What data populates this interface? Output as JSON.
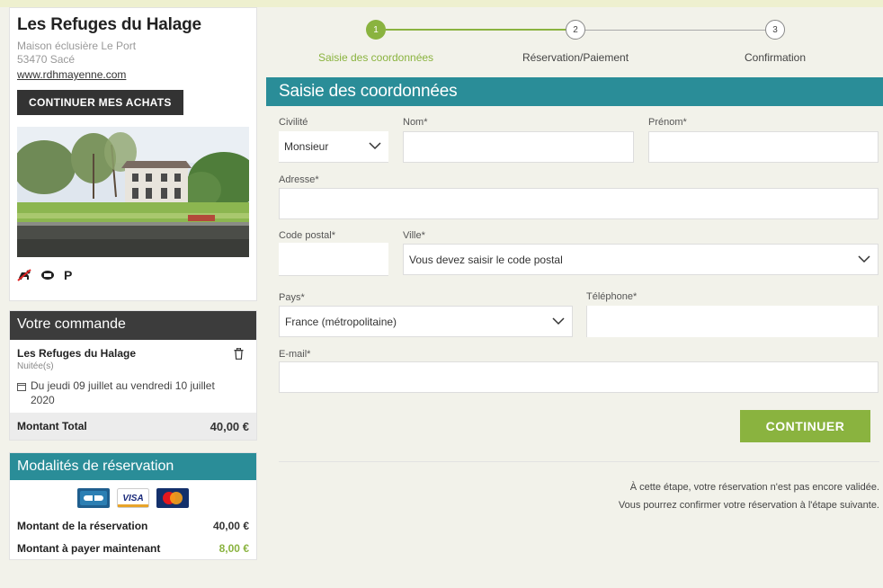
{
  "shop": {
    "name": "Les Refuges du Halage",
    "address_line1": "Maison éclusière Le Port",
    "address_line2": "53470 Sacé",
    "website": "www.rdhmayenne.com",
    "continue_shopping_label": "CONTINUER MES ACHATS",
    "amenity_icons": [
      "no-pets-icon",
      "tv-icon",
      "parking-icon"
    ],
    "parking_glyph": "P"
  },
  "order": {
    "title": "Votre commande",
    "item_name": "Les Refuges du Halage",
    "item_type": "Nuitée(s)",
    "date_line1": "Du jeudi 09 juillet au vendredi 10 juillet",
    "date_line2": "2020",
    "total_label": "Montant Total",
    "total_value": "40,00 €"
  },
  "booking_terms": {
    "title": "Modalités de réservation",
    "cards": [
      "CB",
      "VISA",
      "MasterCard"
    ],
    "amount_label": "Montant de la réservation",
    "amount_value": "40,00 €",
    "pay_now_label": "Montant à payer maintenant",
    "pay_now_value": "8,00 €"
  },
  "stepper": {
    "steps": [
      {
        "number": "1",
        "label": "Saisie des coordonnées",
        "active": true
      },
      {
        "number": "2",
        "label": "Réservation/Paiement",
        "active": false
      },
      {
        "number": "3",
        "label": "Confirmation",
        "active": false
      }
    ]
  },
  "form": {
    "section_title": "Saisie des coordonnées",
    "civilite_label": "Civilité",
    "civilite_value": "Monsieur",
    "nom_label": "Nom*",
    "nom_value": "",
    "prenom_label": "Prénom*",
    "prenom_value": "",
    "adresse_label": "Adresse*",
    "adresse_value": "",
    "code_postal_label": "Code postal*",
    "code_postal_value": "",
    "ville_label": "Ville*",
    "ville_value": "Vous devez saisir le code postal",
    "pays_label": "Pays*",
    "pays_value": "France (métropolitaine)",
    "telephone_label": "Téléphone*",
    "telephone_value": "",
    "email_label": "E-mail*",
    "email_value": "",
    "continue_label": "CONTINUER",
    "note_line1": "À cette étape, votre réservation n'est pas encore validée.",
    "note_line2": "Vous pourrez confirmer votre réservation à l'étape suivante."
  },
  "colors": {
    "accent_green": "#8ab33f",
    "teal": "#2a8d98",
    "dark": "#3c3c3c"
  }
}
